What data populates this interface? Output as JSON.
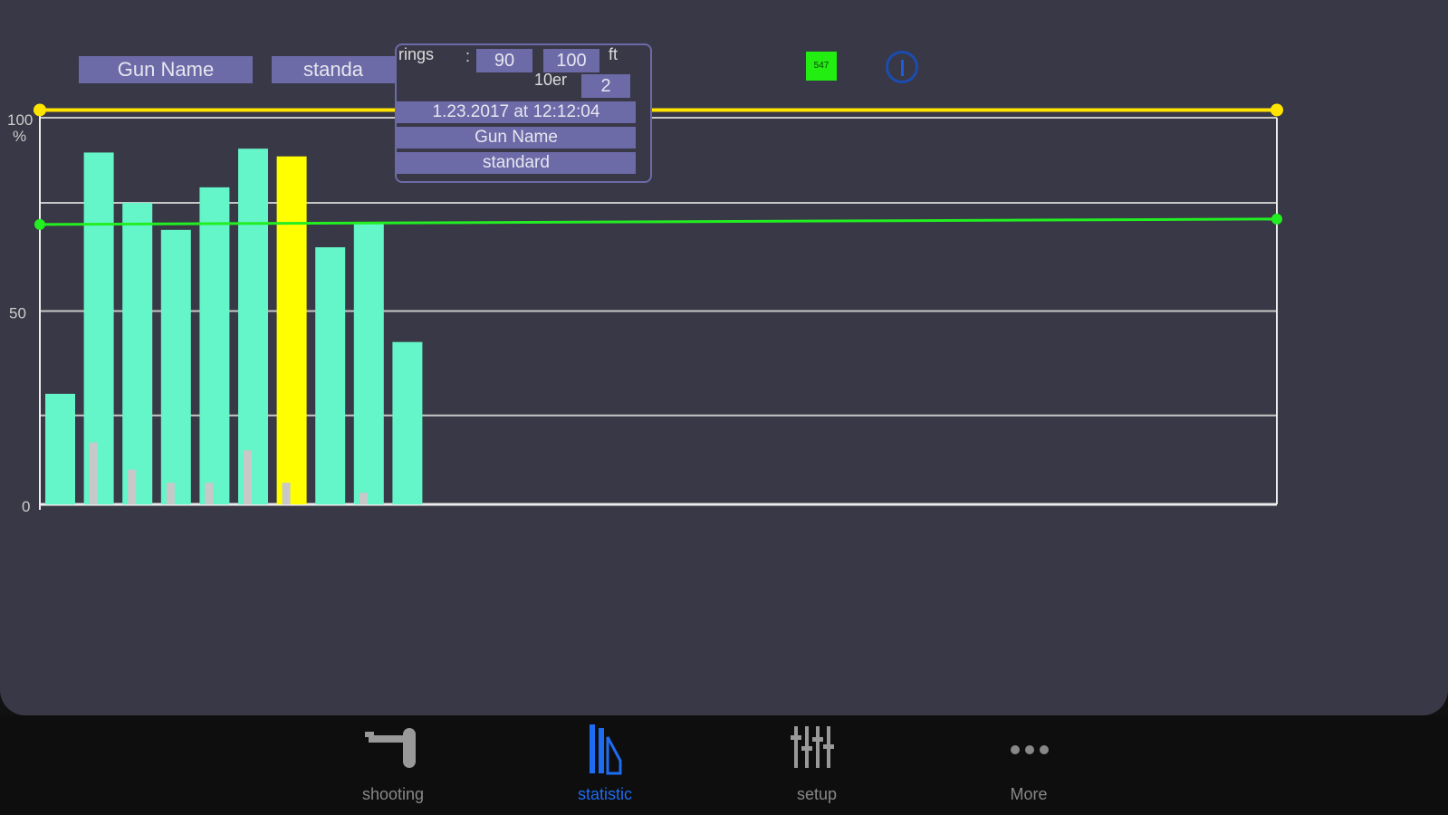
{
  "header": {
    "gun_name": "Gun Name",
    "profile": "standa",
    "badge": "547"
  },
  "popup": {
    "rings_label": "rings",
    "colon": ":",
    "rings_value": "90",
    "distance_value": "100",
    "distance_unit": "ft",
    "tens_label": "10er",
    "tens_value": "2",
    "datetime": "1.23.2017 at 12:12:04",
    "gun_name": "Gun Name",
    "profile": "standard"
  },
  "chart_data": {
    "type": "bar",
    "ylim": [
      0,
      100
    ],
    "yticks": [
      {
        "value": 100,
        "label": "100\n%"
      },
      {
        "value": 50,
        "label": "50"
      },
      {
        "value": 0,
        "label": "0"
      }
    ],
    "gridlines": [
      23,
      50,
      78,
      100
    ],
    "series": [
      {
        "name": "rings %",
        "color": "#64f5c8",
        "values": [
          28.6,
          91,
          78,
          71,
          82,
          92,
          90,
          66.5,
          72.6,
          42
        ]
      },
      {
        "name": "10er %",
        "color": "#c8c8c8",
        "values": [
          0,
          16,
          9,
          5.6,
          5.6,
          14,
          5.6,
          0,
          3,
          0
        ]
      }
    ],
    "highlight_index": 6,
    "highlight_color": "#ffff00",
    "target_line": {
      "value": 102,
      "color": "#ffe400"
    },
    "average_line": {
      "start": 72.4,
      "end": 73.8,
      "color": "#22ee22"
    }
  },
  "tabs": [
    {
      "label": "shooting"
    },
    {
      "label": "statistic",
      "active": true
    },
    {
      "label": "setup"
    },
    {
      "label": "More"
    }
  ]
}
